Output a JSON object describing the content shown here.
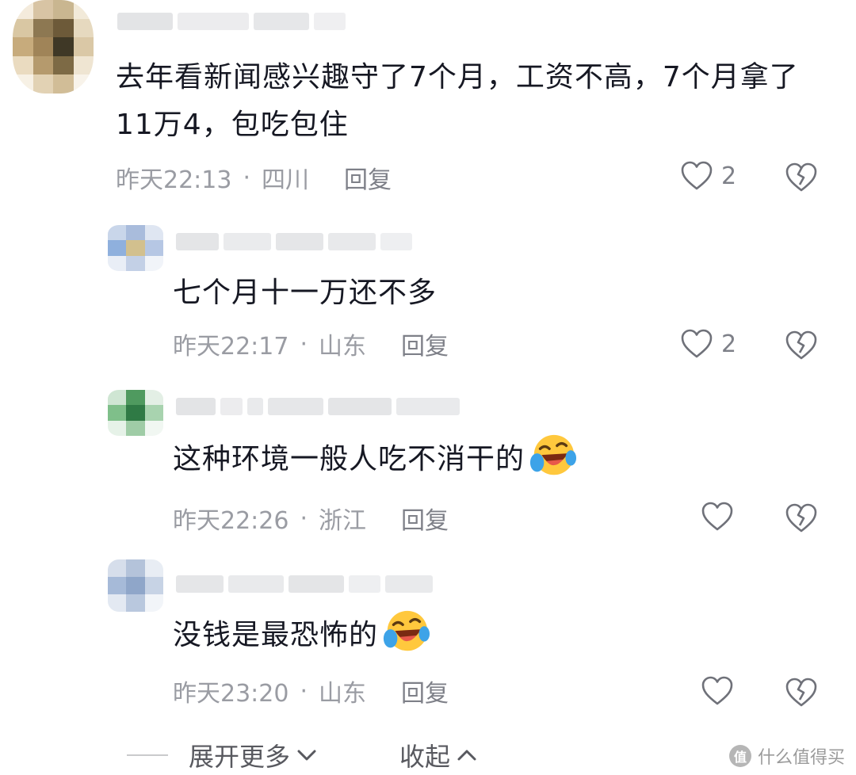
{
  "comments": [
    {
      "text": "去年看新闻感兴趣守了7个月，工资不高，7个月拿了11万4，包吃包住",
      "time": "昨天22:13",
      "location": "四川",
      "reply_label": "回复",
      "likes": "2"
    },
    {
      "text": "七个月十一万还不多",
      "time": "昨天22:17",
      "location": "山东",
      "reply_label": "回复",
      "likes": "2"
    },
    {
      "text": "这种环境一般人吃不消干的",
      "emoji": "laughing-crying-emoji",
      "time": "昨天22:26",
      "location": "浙江",
      "reply_label": "回复",
      "likes": ""
    },
    {
      "text": "没钱是最恐怖的",
      "emoji": "laughing-crying-emoji",
      "time": "昨天23:20",
      "location": "山东",
      "reply_label": "回复",
      "likes": ""
    }
  ],
  "separator": "·",
  "footer": {
    "expand_label": "展开更多",
    "collapse_label": "收起"
  },
  "watermark": {
    "text": "什么值得买",
    "logo_char": "值"
  },
  "icons": {
    "like": "heart-outline-icon",
    "dislike": "broken-heart-icon",
    "expand": "chevron-down-icon",
    "collapse": "chevron-up-icon"
  },
  "colors": {
    "primary_text": "#161823",
    "meta_text": "#9a9ca3",
    "icon": "#7e8088"
  }
}
